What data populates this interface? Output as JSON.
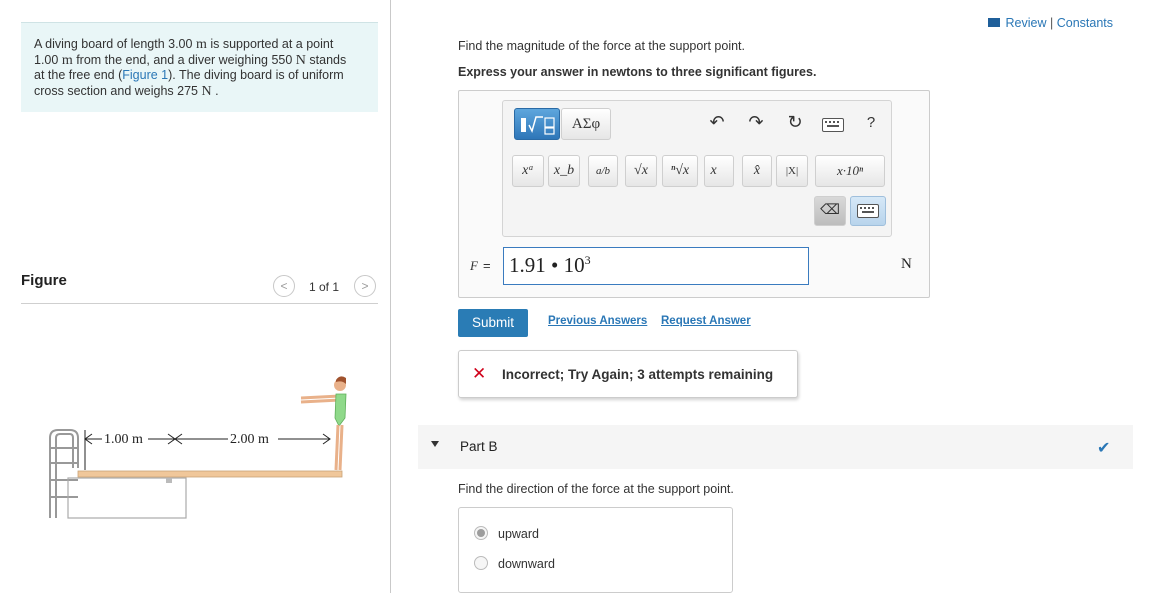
{
  "problem": {
    "segments": [
      {
        "t": "A diving board of length ",
        "c": "text"
      },
      {
        "t": "3.00",
        "c": "text"
      },
      {
        "t": " m",
        "c": "serif"
      },
      {
        "t": " is supported at a point ",
        "c": "text"
      },
      {
        "br": true
      },
      {
        "t": "1.00",
        "c": "text"
      },
      {
        "t": " m",
        "c": "serif"
      },
      {
        "t": " from the end, and a diver weighing 550 ",
        "c": "text"
      },
      {
        "t": "N",
        "c": "serif"
      },
      {
        "t": " stands",
        "c": "text"
      },
      {
        "br": true
      },
      {
        "t": "at the free end (",
        "c": "text"
      },
      {
        "t": "Figure 1",
        "c": "link"
      },
      {
        "t": "). The diving board is of uniform",
        "c": "text"
      },
      {
        "br": true
      },
      {
        "t": "cross section and weighs 275 ",
        "c": "text"
      },
      {
        "t": "N",
        "c": "serif"
      },
      {
        "t": " .",
        "c": "text"
      }
    ]
  },
  "figure": {
    "heading": "Figure",
    "pager": "1 of 1",
    "prev_glyph": "<",
    "next_glyph": ">",
    "dim_left": "1.00 m",
    "dim_right": "2.00 m"
  },
  "header": {
    "review": "Review",
    "separator": " | ",
    "constants": "Constants"
  },
  "partA": {
    "question": "Find the magnitude of the force at the support point.",
    "instructions": "Express your answer in newtons to three significant figures.",
    "toolbar": {
      "greek": "ΑΣφ",
      "undo": "↶",
      "redo": "↷",
      "reset": "↻",
      "help": "?",
      "row2": [
        "xᵃ",
        "x_b",
        "a/b",
        "√x",
        "ⁿ√x",
        "x⃗",
        "x̂",
        "|X|",
        "x·10ⁿ"
      ],
      "backspace": "⌫"
    },
    "variable": "F",
    "equals": "=",
    "answer_mantissa": "1.91",
    "answer_dot": " • ",
    "answer_base": "10",
    "answer_exp": "3",
    "unit": "N",
    "submit": "Submit",
    "previous_answers": "Previous Answers",
    "request_answer": "Request Answer",
    "feedback_icon": "✕",
    "feedback": "Incorrect; Try Again; 3 attempts remaining"
  },
  "partB": {
    "title": "Part B",
    "check_glyph": "✔",
    "question": "Find the direction of the force at the support point.",
    "options": [
      "upward",
      "downward"
    ],
    "selected": 0
  },
  "colors": {
    "accent": "#2a7cb5",
    "link": "#2a77b6",
    "error": "#d0021b",
    "problem_bg": "#e9f6f7",
    "board": "#f0c79a",
    "swimsuit": "#8fd98a"
  }
}
